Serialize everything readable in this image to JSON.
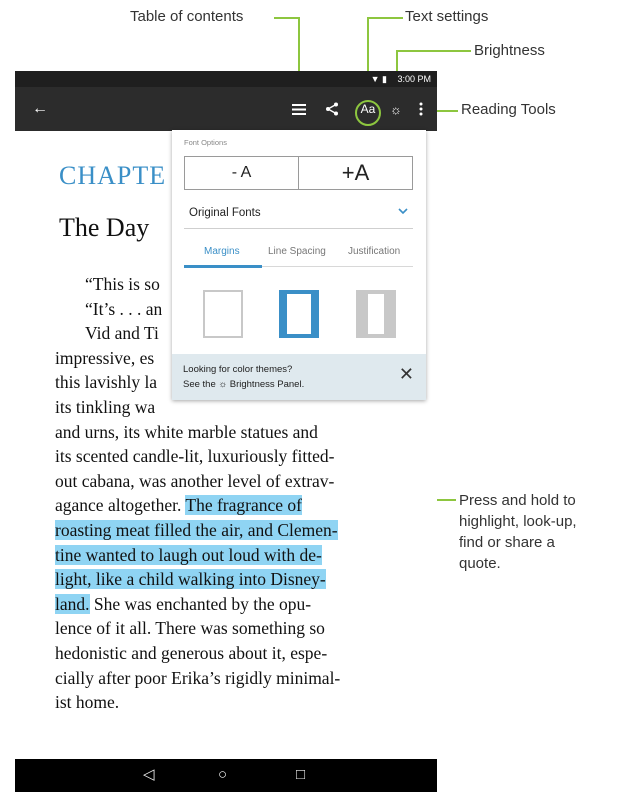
{
  "callouts": {
    "toc": "Table of contents",
    "text_settings": "Text settings",
    "brightness": "Brightness",
    "reading_tools": "Reading Tools",
    "highlight": [
      "Press and hold to",
      "highlight, look-up,",
      "find or share a",
      "quote."
    ]
  },
  "status_bar": {
    "time": "3:00 PM"
  },
  "toolbar": {
    "text_settings_label": "Aa"
  },
  "book": {
    "chapter": "CHAPTE",
    "title": "The Day",
    "lines": [
      "“This is so",
      "“It’s . . . an",
      "Vid and Ti",
      "impressive, es",
      "this lavishly la",
      "its tinkling wa",
      "and urns, its white marble statues and",
      "its scented candle-lit, luxuriously fitted-",
      "out cabana, was another level of extrav-",
      "agance altogether.",
      "The fragrance of",
      "roasting meat filled the air, and Clemen-",
      "tine wanted to laugh out loud with de-",
      "light, like a child walking into Disney-",
      "land.",
      "She was enchanted by the opu-",
      "lence of it all. There was something so",
      "hedonistic and generous about it, espe-",
      "cially after poor Erika’s rigidly minimal-",
      "ist home."
    ]
  },
  "font_options": {
    "title": "Font Options",
    "decrease": "- A",
    "increase": "+A",
    "font": "Original Fonts",
    "tabs": [
      "Margins",
      "Line Spacing",
      "Justification"
    ],
    "active_tab": "Margins",
    "themes_line1": "Looking for color themes?",
    "themes_see": "See the",
    "themes_panel": "Brightness Panel."
  },
  "colors": {
    "accent": "#3a8fc7",
    "highlight": "#8fd4f3",
    "callout_line": "#8dc63f",
    "app_bar": "#2c2c2c"
  }
}
